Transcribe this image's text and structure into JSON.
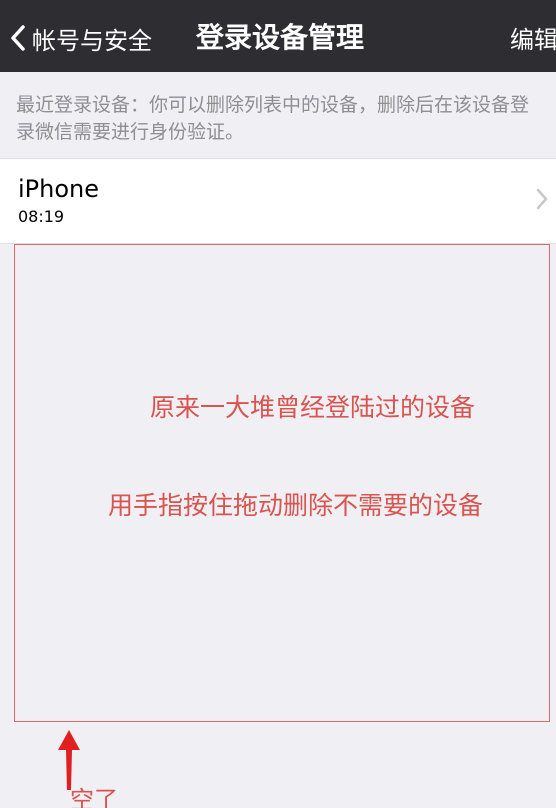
{
  "navbar": {
    "back_label": "帐号与安全",
    "title": "登录设备管理",
    "edit_label": "编辑"
  },
  "hint_text": "最近登录设备：你可以删除列表中的设备，删除后在该设备登录微信需要进行身份验证。",
  "devices": [
    {
      "name": "iPhone",
      "time": "08:19"
    }
  ],
  "annotation": {
    "line1": "原来一大堆曾经登陆过的设备",
    "line2": "用手指按住拖动删除不需要的设备",
    "empty_label": "空了",
    "color": "#d9534f"
  },
  "colors": {
    "navbar_bg": "#2e2e32",
    "page_bg": "#efeff4",
    "hint_text": "#8e8e93"
  }
}
